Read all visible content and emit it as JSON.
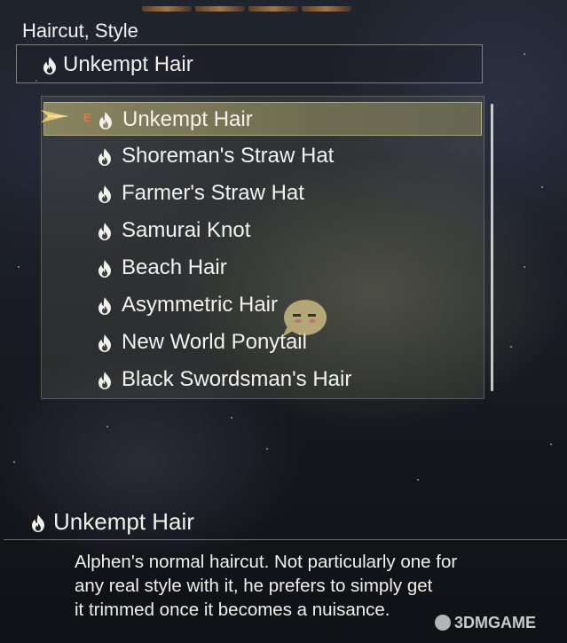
{
  "category": {
    "label": "Haircut, Style"
  },
  "current_selection": {
    "name": "Unkempt Hair",
    "icon": "flame-icon"
  },
  "list": {
    "selected_index": 0,
    "equipped_marker": "E",
    "items": [
      {
        "label": "Unkempt Hair",
        "icon": "flame-icon"
      },
      {
        "label": "Shoreman's Straw Hat",
        "icon": "flame-icon"
      },
      {
        "label": "Farmer's Straw Hat",
        "icon": "flame-icon"
      },
      {
        "label": "Samurai Knot",
        "icon": "flame-icon"
      },
      {
        "label": "Beach Hair",
        "icon": "flame-icon"
      },
      {
        "label": "Asymmetric Hair",
        "icon": "flame-icon"
      },
      {
        "label": "New World Ponytail",
        "icon": "flame-icon"
      },
      {
        "label": "Black Swordsman's Hair",
        "icon": "flame-icon"
      }
    ]
  },
  "detail": {
    "title": "Unkempt Hair",
    "description_lines": [
      "Alphen's normal haircut. Not particularly one for",
      "any real style with it, he prefers to simply get",
      "it trimmed once it becomes a nuisance."
    ]
  },
  "watermark": {
    "text": "3DMGAME"
  },
  "colors": {
    "accent_cursor": "#e8c878",
    "equip_mark": "#e07a4e",
    "highlight": "#948f64"
  }
}
